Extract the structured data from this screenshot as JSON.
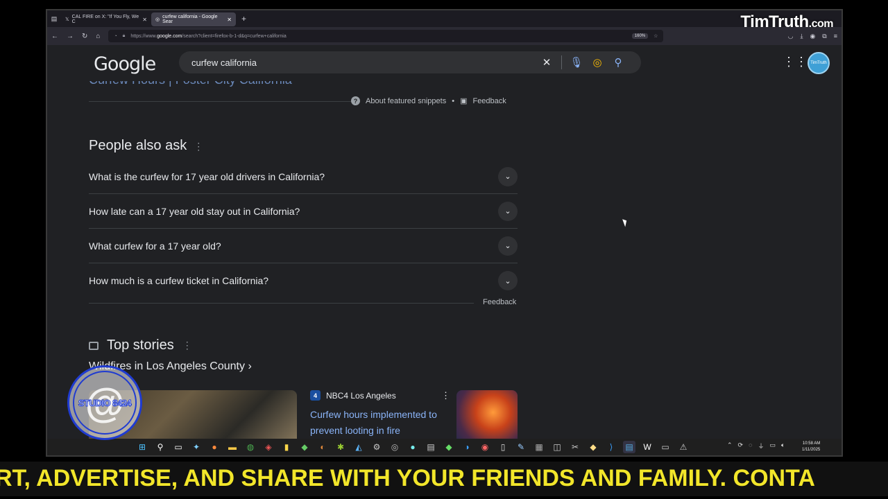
{
  "browser": {
    "tabs": [
      {
        "label": "CAL FIRE on X: \"If You Fly, We C",
        "icon": "x-logo-icon",
        "active": false
      },
      {
        "label": "curfew california - Google Sear",
        "icon": "google-icon",
        "active": true
      }
    ],
    "url_prefix": "https://www.",
    "url_domain": "google.com",
    "url_rest": "/search?client=firefox-b-1-d&q=curfew+california",
    "zoom": "160%"
  },
  "watermark": {
    "main": "TimTruth",
    "suffix": ".com"
  },
  "google": {
    "logo": "Google",
    "query": "curfew california",
    "avatar_text": "TimTruth"
  },
  "snippet": {
    "cut_title": "Curfew Hours | Foster City California",
    "about_label": "About featured snippets",
    "dot": "•",
    "feedback_label": "Feedback"
  },
  "paa": {
    "title": "People also ask",
    "questions": [
      "What is the curfew for 17 year old drivers in California?",
      "How late can a 17 year old stay out in California?",
      "What curfew for a 17 year old?",
      "How much is a curfew ticket in California?"
    ],
    "feedback_label": "Feedback"
  },
  "top_stories": {
    "title": "Top stories",
    "subtitle": "Wildfires in Los Angeles County",
    "source": "NBC4 Los Angeles",
    "headline": "Curfew hours implemented to prevent looting in fire"
  },
  "taskbar": {
    "time": "10:58 AM",
    "date": "1/11/2025"
  },
  "studio_badge": "STUDIO 8424",
  "ticker": "RT, ADVERTISE, AND SHARE WITH YOUR FRIENDS AND FAMILY. CONTA"
}
